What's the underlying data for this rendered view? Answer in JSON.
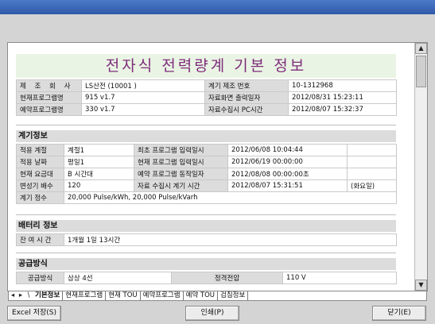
{
  "report_title": "전자식 전력량계 기본 정보",
  "basic": {
    "rows": [
      {
        "l1": "제 조 회 사",
        "v1": "LS산전   (10001 )",
        "l2": "계기 제조 번호",
        "v2": "10-1312968"
      },
      {
        "l1": "현재프로그램명",
        "v1": "915 v1.7",
        "l2": "자료화면 출력일자",
        "v2": "2012/08/31   15:23:11"
      },
      {
        "l1": "예약프로그램명",
        "v1": "330 v1.7",
        "l2": "자료수집시 PC시간",
        "v2": "2012/08/07   15:32:37"
      }
    ]
  },
  "meter_info": {
    "title": "계기정보",
    "rows": [
      {
        "l1": "적용  계절",
        "v1": "계절1",
        "l2": "최초 프로그램 입력일시",
        "v2": "2012/06/08   10:04:44",
        "v3": ""
      },
      {
        "l1": "적용  날짜",
        "v1": "평일1",
        "l2": "현재 프로그램 입력일시",
        "v2": "2012/06/19   00:00:00",
        "v3": ""
      },
      {
        "l1": "현재 요금대",
        "v1": "B 시간대",
        "l2": "예약 프로그램 동작일자",
        "v2": "2012/08/08   00:00:00초",
        "v3": ""
      },
      {
        "l1": "변성기 배수",
        "v1": "120",
        "l2": "자료 수집시 계기 시간",
        "v2": "2012/08/07   15:31:51",
        "v3": "(화요일)"
      }
    ],
    "constant_label": "계기  정수",
    "constant_value": "20,000 Pulse/kWh,  20,000 Pulse/kVarh"
  },
  "battery": {
    "title": "배터리 정보",
    "label": "잔 여 시 간",
    "value": "1개월 1일 13시간"
  },
  "supply": {
    "title": "공급방식",
    "label": "공급방식",
    "value": "삼상 4선",
    "label2": "정격전압",
    "value2": "110 V"
  },
  "tabs": {
    "nav": [
      "◂",
      "▸",
      "\\"
    ],
    "items": [
      "기본정보",
      "현재프로그램",
      "현재 TOU",
      "예약프로그램",
      "예약 TOU",
      "검침정보"
    ]
  },
  "buttons": {
    "excel": "Excel 저장(S)",
    "print": "인쇄(P)",
    "close": "닫기(E)"
  },
  "scroll": {
    "up": "▲",
    "down": "▼"
  }
}
